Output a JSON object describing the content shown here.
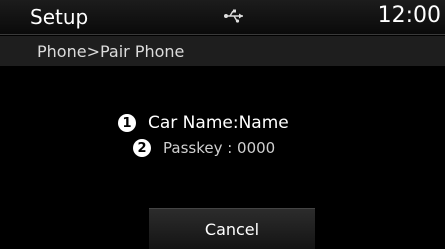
{
  "status": {
    "title": "Setup",
    "icon": "usb-icon",
    "time": "12:00"
  },
  "breadcrumb": "Phone>Pair Phone",
  "pairing": {
    "items": [
      {
        "number": "1",
        "label": "Car Name:",
        "value": "Name"
      },
      {
        "number": "2",
        "label": "Passkey : 0000"
      }
    ]
  },
  "cancel_label": "Cancel"
}
